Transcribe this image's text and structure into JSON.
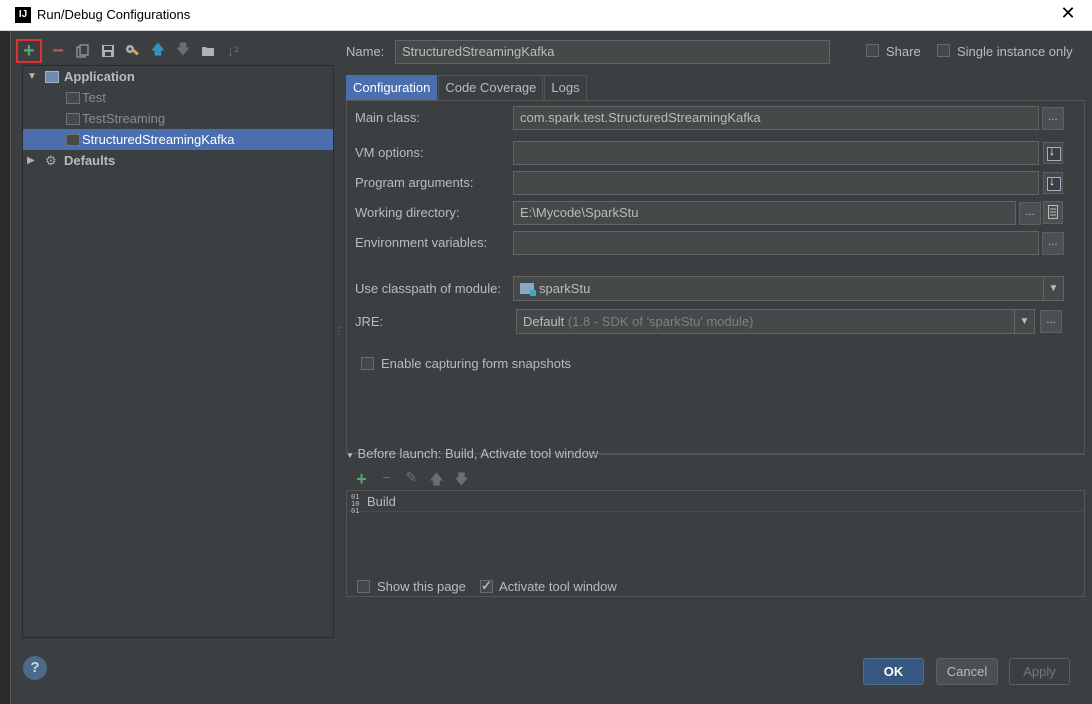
{
  "window": {
    "title": "Run/Debug Configurations",
    "icon_text": "IJ",
    "close_glyph": "✕"
  },
  "left_toolbar": {
    "icons": [
      "add-icon",
      "remove-icon",
      "copy-icon",
      "save-icon",
      "wrench-icon",
      "move-up-icon",
      "move-down-icon",
      "folder-icon",
      "sort-icon"
    ]
  },
  "tree": {
    "application": "Application",
    "items": [
      "Test",
      "TestStreaming",
      "StructuredStreamingKafka"
    ],
    "defaults": "Defaults"
  },
  "header": {
    "name_label": "Name:",
    "name_value": "StructuredStreamingKafka",
    "share_label": "Share",
    "single_instance_label": "Single instance only"
  },
  "tabs": [
    "Configuration",
    "Code Coverage",
    "Logs"
  ],
  "config": {
    "main_class_label": "Main class:",
    "main_class_value": "com.spark.test.StructuredStreamingKafka",
    "vm_options_label": "VM options:",
    "vm_options_value": "",
    "program_args_label": "Program arguments:",
    "program_args_value": "",
    "working_dir_label": "Working directory:",
    "working_dir_value": "E:\\Mycode\\SparkStu",
    "env_vars_label": "Environment variables:",
    "env_vars_value": "",
    "classpath_label": "Use classpath of module:",
    "classpath_value": "sparkStu",
    "jre_label": "JRE:",
    "jre_value": "Default",
    "jre_hint": "(1.8 - SDK of 'sparkStu' module)",
    "snapshots_label": "Enable capturing form snapshots",
    "ellipsis": "..."
  },
  "before_launch": {
    "title": "Before launch: Build, Activate tool window",
    "items": [
      "Build"
    ]
  },
  "footer": {
    "show_page_label": "Show this page",
    "activate_tool_label": "Activate tool window",
    "ok": "OK",
    "cancel": "Cancel",
    "apply": "Apply",
    "help": "?"
  }
}
